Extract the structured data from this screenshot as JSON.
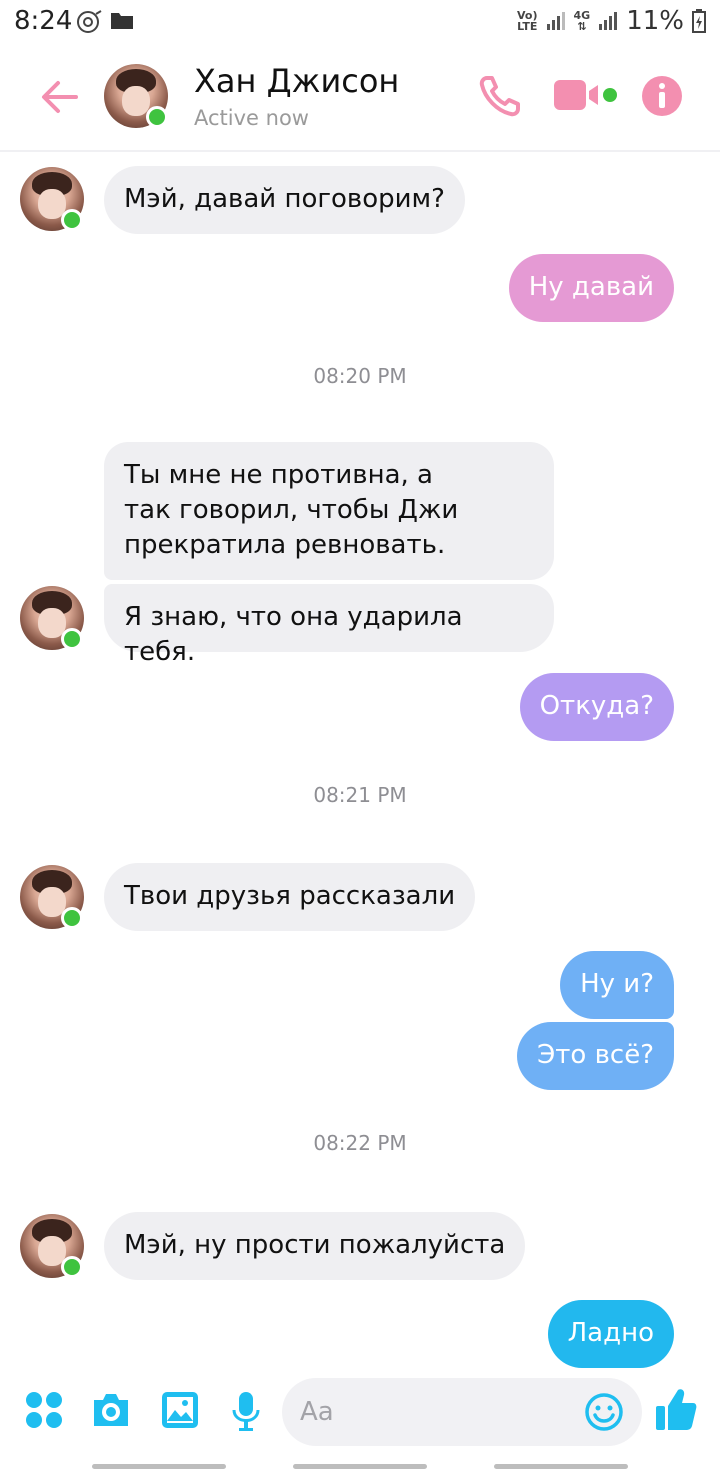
{
  "status_bar": {
    "time": "8:24",
    "network_label_top": "Vo)",
    "network_label_bottom": "LTE",
    "generation_label": "4G",
    "battery": "11%"
  },
  "header": {
    "contact_name": "Хан Джисон",
    "status_text": "Active now",
    "accent_color": "#f38fb0",
    "icons": [
      "back-arrow-icon",
      "phone-icon",
      "video-camera-icon",
      "info-icon"
    ]
  },
  "messages": [
    {
      "direction": "in",
      "text": "Мэй, давай поговорим?",
      "color": "#efeff2"
    },
    {
      "direction": "out",
      "text": "Ну давай",
      "color": "#e59ad4"
    },
    {
      "direction": "time",
      "text": "08:20 PM"
    },
    {
      "direction": "in",
      "text": "Ты мне не противна, а\nтак говорил, чтобы Джи\nпрекратила ревновать.",
      "color": "#efeff2"
    },
    {
      "direction": "in",
      "text": "Я знаю, что она ударила тебя.",
      "color": "#efeff2"
    },
    {
      "direction": "out",
      "text": "Откуда?",
      "color": "#b49bf2"
    },
    {
      "direction": "time",
      "text": "08:21 PM"
    },
    {
      "direction": "in",
      "text": "Твои друзья рассказали",
      "color": "#efeff2"
    },
    {
      "direction": "out",
      "text": "Ну и?",
      "color": "#6fb0f5"
    },
    {
      "direction": "out",
      "text": "Это всё?",
      "color": "#6fb0f5"
    },
    {
      "direction": "time",
      "text": "08:22 PM"
    },
    {
      "direction": "in",
      "text": "Мэй, ну прости пожалуйста",
      "color": "#efeff2"
    },
    {
      "direction": "out",
      "text": "Ладно",
      "color": "#22b8ee"
    }
  ],
  "composer": {
    "placeholder": "Aa",
    "accent_color": "#1fbef0",
    "icons": [
      "apps-icon",
      "camera-icon",
      "image-icon",
      "microphone-icon",
      "emoji-icon",
      "thumbs-up-icon"
    ]
  },
  "online_color": "#3fc33f"
}
